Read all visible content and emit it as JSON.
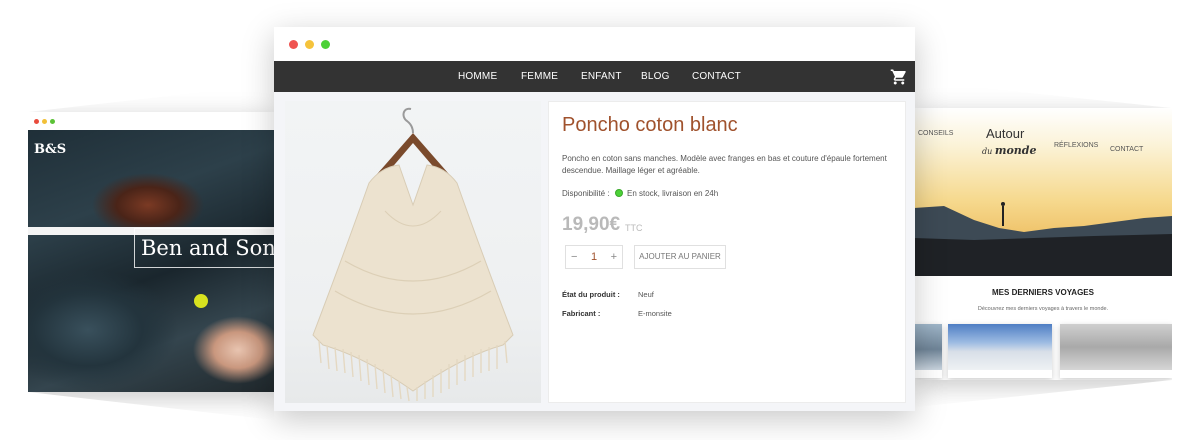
{
  "left_site": {
    "logo": "B&S",
    "hero_text": "Ben and Sons",
    "window_dots": [
      "#e94b3c",
      "#f2c037",
      "#5bc236"
    ]
  },
  "main": {
    "window_dots": [
      "#ef5350",
      "#f5c33b",
      "#4cd137"
    ],
    "nav": [
      "HOMME",
      "FEMME",
      "ENFANT",
      "BLOG",
      "CONTACT"
    ],
    "cart_icon": "shopping-cart-icon",
    "product": {
      "title": "Poncho coton blanc",
      "description": "Poncho en coton sans manches. Modèle avec franges en bas et couture d'épaule fortement descendue. Maillage léger et agréable.",
      "availability_label": "Disponibilité :",
      "availability_text": "En stock, livraison en 24h",
      "availability_color": "#4cd137",
      "price": "19,90€",
      "price_suffix": "TTC",
      "quantity": "1",
      "qty_minus": "−",
      "qty_plus": "+",
      "add_to_cart": "AJOUTER AU PANIER",
      "specs": [
        {
          "label": "État du produit :",
          "value": "Neuf"
        },
        {
          "label": "Fabricant :",
          "value": "E-monsite"
        }
      ]
    },
    "accent_color": "#a0522d"
  },
  "right_site": {
    "nav": [
      "CONSEILS",
      "RÉFLEXIONS",
      "CONTACT"
    ],
    "logo_line1": "Autour",
    "logo_line2_prefix": "du",
    "logo_line2_word": "monde",
    "section_title": "MES DERNIERS VOYAGES",
    "section_subtitle": "Découvrez mes derniers voyages à travers le monde."
  }
}
